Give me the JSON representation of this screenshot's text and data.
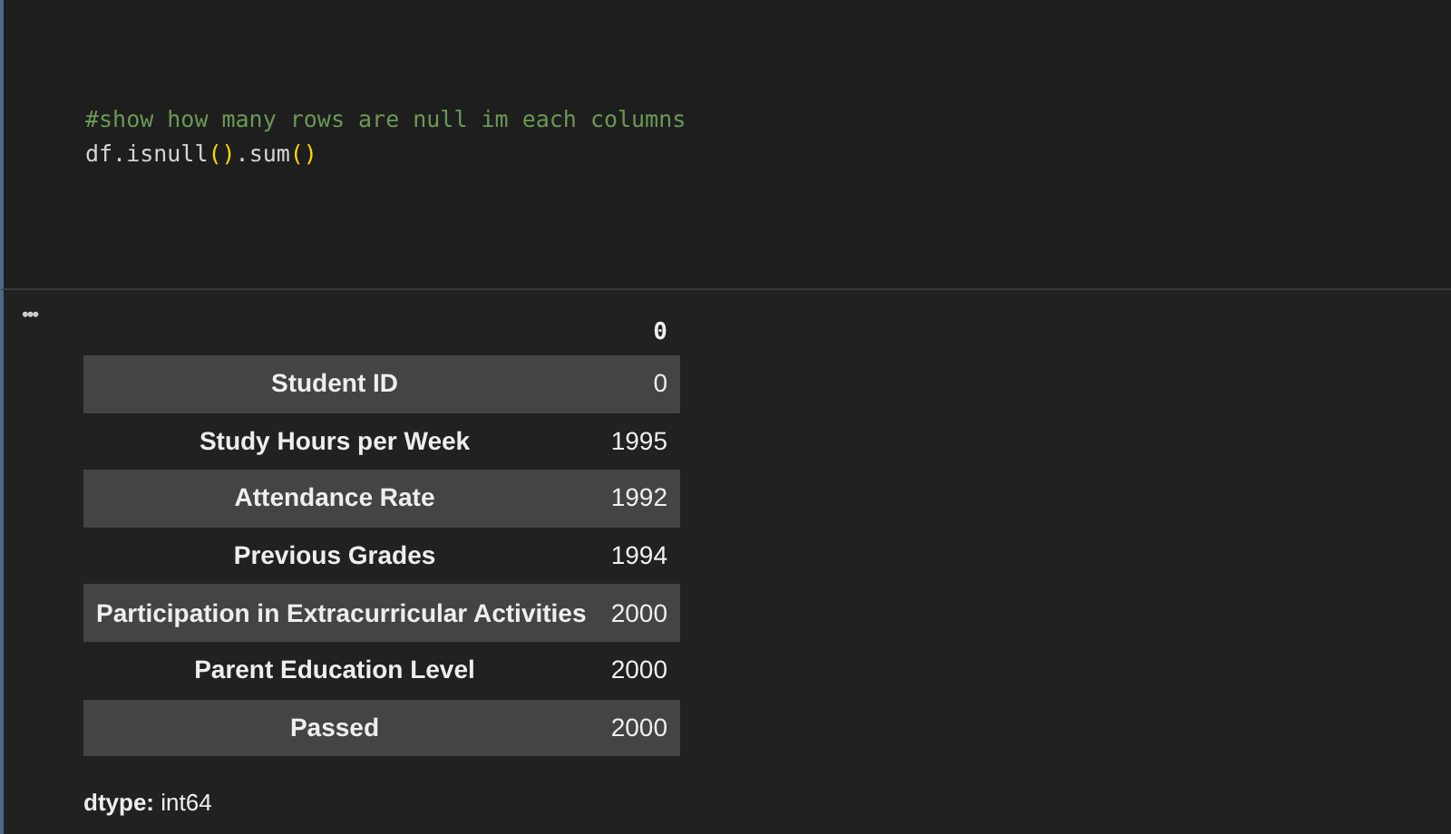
{
  "code_cell": {
    "lines": [
      [
        {
          "kind": "comment",
          "text": "#show how many rows are null im each columns"
        }
      ],
      [
        {
          "kind": "plain",
          "text": "df.isnull"
        },
        {
          "kind": "bracket",
          "text": "()"
        },
        {
          "kind": "plain",
          "text": ".sum"
        },
        {
          "kind": "bracket",
          "text": "()"
        }
      ]
    ]
  },
  "output": {
    "menu": "•••",
    "table": {
      "column": "0",
      "rows": [
        {
          "label": "Student ID",
          "value": "0"
        },
        {
          "label": "Study Hours per Week",
          "value": "1995"
        },
        {
          "label": "Attendance Rate",
          "value": "1992"
        },
        {
          "label": "Previous Grades",
          "value": "1994"
        },
        {
          "label": "Participation in Extracurricular Activities",
          "value": "2000"
        },
        {
          "label": "Parent Education Level",
          "value": "2000"
        },
        {
          "label": "Passed",
          "value": "2000"
        }
      ]
    },
    "dtype": {
      "label": "dtype:",
      "value": "int64"
    }
  }
}
